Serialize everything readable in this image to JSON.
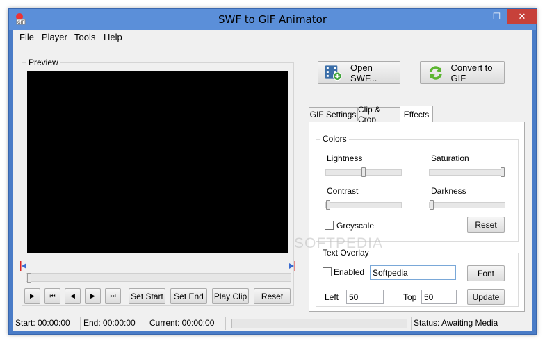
{
  "window": {
    "title": "SWF to GIF Animator",
    "minimize_glyph": "—",
    "maximize_glyph": "☐",
    "close_glyph": "✕"
  },
  "menu": [
    "File",
    "Player",
    "Tools",
    "Help"
  ],
  "preview": {
    "label": "Preview",
    "seek_position": 0
  },
  "playback_buttons": {
    "play": "▶",
    "first": "⏮",
    "prev": "◀",
    "next": "▶",
    "last": "⏭"
  },
  "clip_buttons": [
    "Set Start",
    "Set End",
    "Play Clip",
    "Reset"
  ],
  "actions": {
    "open": "Open SWF...",
    "convert": "Convert to GIF"
  },
  "tabs": [
    "GIF Settings",
    "Clip & Crop",
    "Effects"
  ],
  "active_tab": "Effects",
  "colors": {
    "label": "Colors",
    "lightness_label": "Lightness",
    "saturation_label": "Saturation",
    "contrast_label": "Contrast",
    "darkness_label": "Darkness",
    "lightness": 0.5,
    "saturation": 1.0,
    "contrast": 0.0,
    "darkness": 0.0,
    "greyscale_label": "Greyscale",
    "greyscale_checked": false,
    "reset_label": "Reset"
  },
  "text_overlay": {
    "label": "Text Overlay",
    "enabled_label": "Enabled",
    "enabled_checked": false,
    "text_value": "Softpedia",
    "font_label": "Font",
    "left_label": "Left",
    "left_value": "50",
    "top_label": "Top",
    "top_value": "50",
    "update_label": "Update"
  },
  "status": {
    "start": "Start: 00:00:00",
    "end": "End: 00:00:00",
    "current": "Current: 00:00:00",
    "progress": 0,
    "status_text": "Status: Awaiting Media"
  },
  "watermark": "SOFTPEDIA",
  "theme": {
    "frame": "#4a7cc7",
    "close": "#c7413a",
    "film_icon": "#3b6ea8",
    "convert_icon": "#5cb531"
  }
}
